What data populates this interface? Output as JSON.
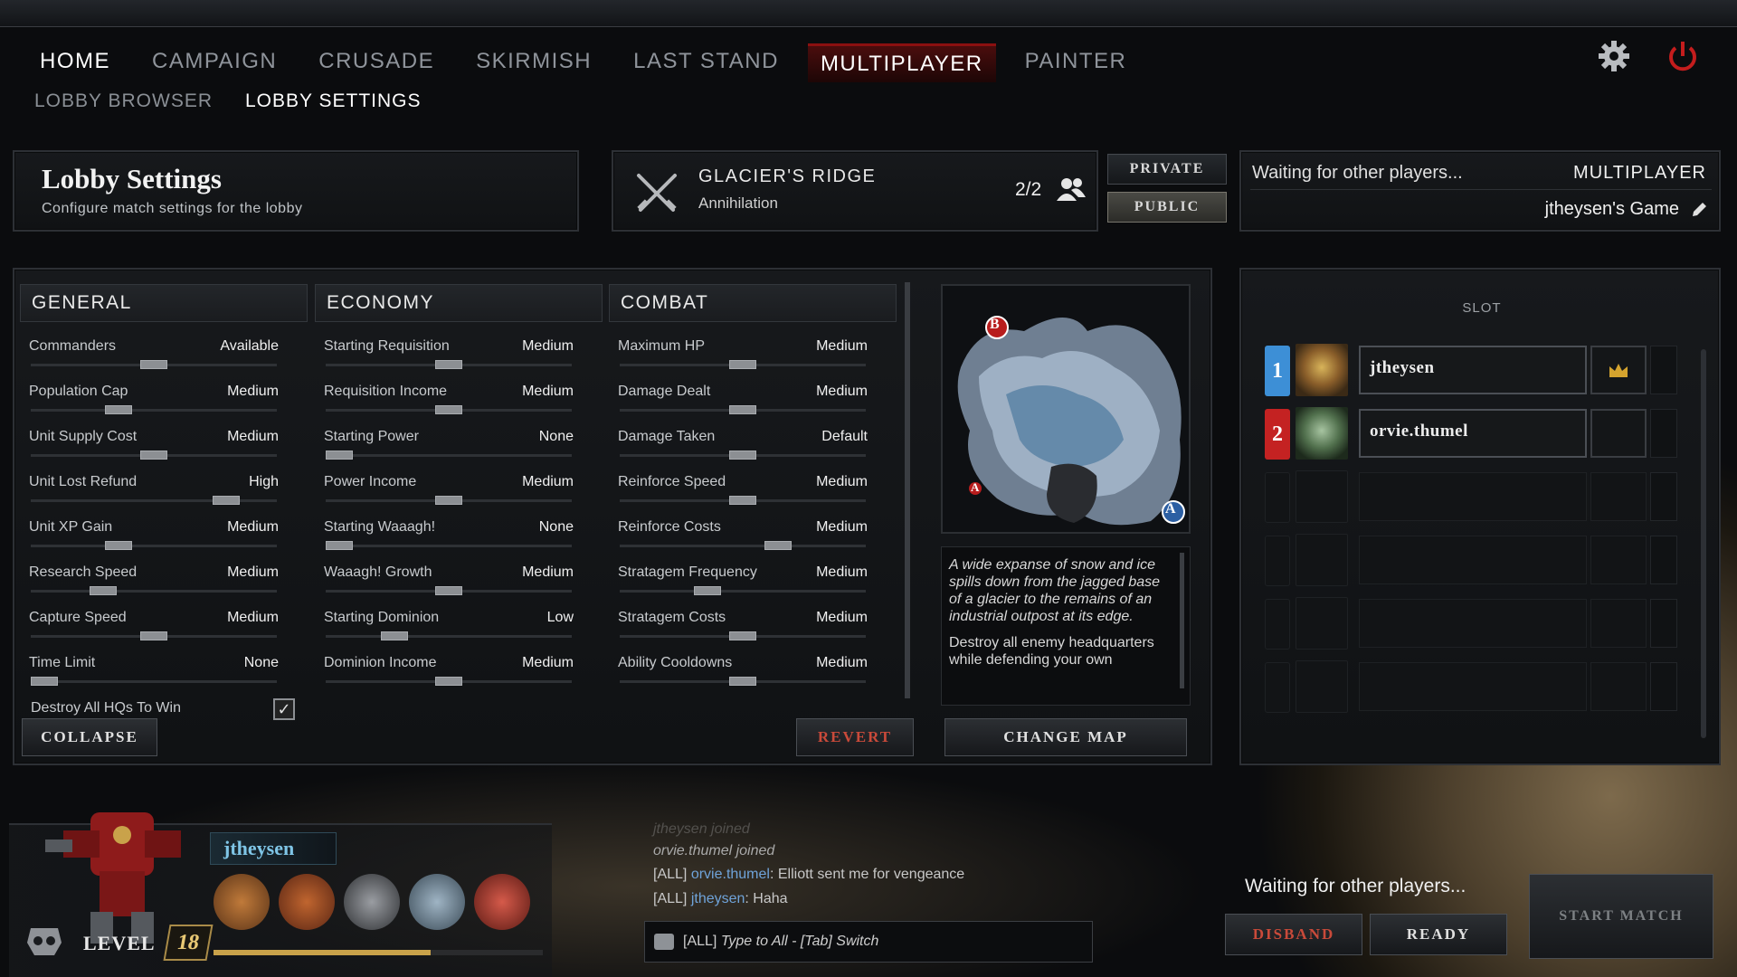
{
  "nav": {
    "items": [
      "HOME",
      "CAMPAIGN",
      "CRUSADE",
      "SKIRMISH",
      "LAST STAND",
      "MULTIPLAYER",
      "PAINTER"
    ],
    "active": "MULTIPLAYER"
  },
  "subnav": {
    "lobby_browser": "LOBBY BROWSER",
    "lobby_settings": "LOBBY SETTINGS"
  },
  "header": {
    "title": "Lobby Settings",
    "subtitle": "Configure match settings for the lobby",
    "map_name": "GLACIER'S RIDGE",
    "map_mode": "Annihilation",
    "player_count": "2/2",
    "private_label": "PRIVATE",
    "public_label": "PUBLIC",
    "status": "Waiting for other players...",
    "mode": "MULTIPLAYER",
    "game_name": "jtheysen's Game"
  },
  "settings": {
    "general": {
      "title": "GENERAL",
      "rows": [
        {
          "label": "Commanders",
          "value": "Available",
          "level": 0.5
        },
        {
          "label": "Population Cap",
          "value": "Medium",
          "level": 0.34
        },
        {
          "label": "Unit Supply Cost",
          "value": "Medium",
          "level": 0.5
        },
        {
          "label": "Unit Lost Refund",
          "value": "High",
          "level": 0.83
        },
        {
          "label": "Unit XP Gain",
          "value": "Medium",
          "level": 0.34
        },
        {
          "label": "Research Speed",
          "value": "Medium",
          "level": 0.27
        },
        {
          "label": "Capture Speed",
          "value": "Medium",
          "level": 0.5
        },
        {
          "label": "Time Limit",
          "value": "None",
          "level": 0.0
        }
      ],
      "checkbox_label": "Destroy All HQs To Win",
      "checkbox_checked": true
    },
    "economy": {
      "title": "ECONOMY",
      "rows": [
        {
          "label": "Starting Requisition",
          "value": "Medium",
          "level": 0.5
        },
        {
          "label": "Requisition Income",
          "value": "Medium",
          "level": 0.5
        },
        {
          "label": "Starting Power",
          "value": "None",
          "level": 0.0
        },
        {
          "label": "Power Income",
          "value": "Medium",
          "level": 0.5
        },
        {
          "label": "Starting Waaagh!",
          "value": "None",
          "level": 0.0
        },
        {
          "label": "Waaagh! Growth",
          "value": "Medium",
          "level": 0.5
        },
        {
          "label": "Starting Dominion",
          "value": "Low",
          "level": 0.25
        },
        {
          "label": "Dominion Income",
          "value": "Medium",
          "level": 0.5
        }
      ]
    },
    "combat": {
      "title": "COMBAT",
      "rows": [
        {
          "label": "Maximum HP",
          "value": "Medium",
          "level": 0.5
        },
        {
          "label": "Damage Dealt",
          "value": "Medium",
          "level": 0.5
        },
        {
          "label": "Damage Taken",
          "value": "Default",
          "level": 0.5
        },
        {
          "label": "Reinforce Speed",
          "value": "Medium",
          "level": 0.5
        },
        {
          "label": "Reinforce Costs",
          "value": "Medium",
          "level": 0.66
        },
        {
          "label": "Stratagem Frequency",
          "value": "Medium",
          "level": 0.34
        },
        {
          "label": "Stratagem Costs",
          "value": "Medium",
          "level": 0.5
        },
        {
          "label": "Ability Cooldowns",
          "value": "Medium",
          "level": 0.5
        }
      ]
    }
  },
  "buttons": {
    "collapse": "COLLAPSE",
    "revert": "REVERT",
    "change_map": "CHANGE MAP",
    "disband": "DISBAND",
    "ready": "READY",
    "start_match": "START MATCH"
  },
  "map": {
    "marker_b": "B",
    "marker_a_small": "A",
    "marker_a": "A",
    "description": "A wide expanse of snow and ice spills down from the jagged base of a glacier to the remains of an industrial outpost at its edge.",
    "objective": "Destroy all enemy headquarters while defending your own"
  },
  "slots": {
    "header": "SLOT",
    "players": [
      {
        "number": "1",
        "name": "jtheysen",
        "color": "#3d8fd6",
        "host": true
      },
      {
        "number": "2",
        "name": "orvie.thumel",
        "color": "#c42222",
        "host": false
      }
    ]
  },
  "player": {
    "name": "jtheysen",
    "level_label": "LEVEL",
    "level": "18",
    "xp_progress": 0.66
  },
  "chat": {
    "faded_line": "jtheysen joined",
    "join_line": "orvie.thumel joined",
    "messages": [
      {
        "channel": "[ALL]",
        "user": "orvie.thumel",
        "text": ": Elliott sent me for vengeance"
      },
      {
        "channel": "[ALL]",
        "user": "jtheysen",
        "text": ": Haha"
      }
    ],
    "input_channel": "[ALL]",
    "input_placeholder": "Type to All - [Tab] Switch"
  },
  "footer_status": "Waiting for other players...",
  "colors": {
    "accent_red": "#8b1010",
    "blue_slot": "#3d8fd6",
    "red_slot": "#c42222",
    "xp_gold": "#c9a24a"
  }
}
